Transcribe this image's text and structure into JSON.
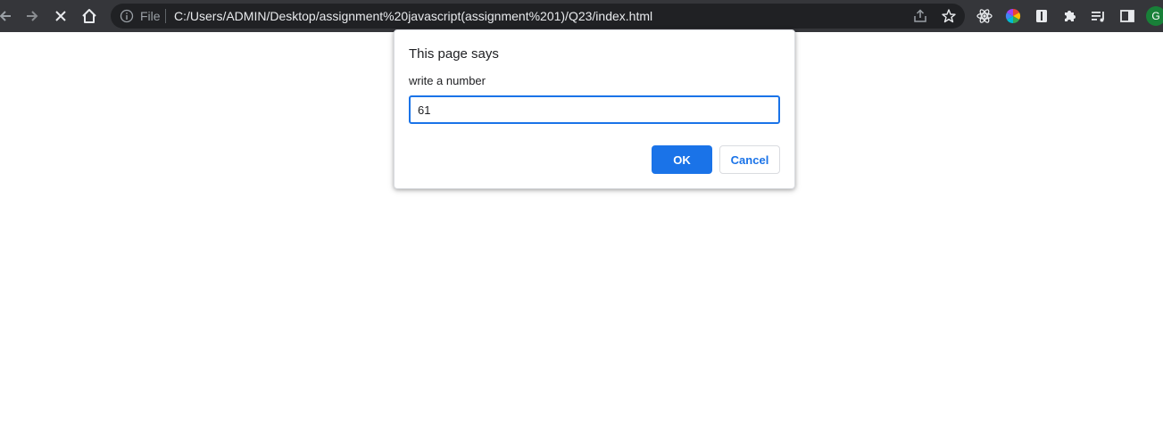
{
  "browser": {
    "scheme_label": "File",
    "url": "C:/Users/ADMIN/Desktop/assignment%20javascript(assignment%201)/Q23/index.html",
    "profile_initial": "G",
    "icons": {
      "back": "arrow-left-icon",
      "forward": "arrow-right-icon",
      "stop": "close-icon",
      "home": "home-icon",
      "info": "info-icon",
      "share": "share-icon",
      "bookmark": "star-icon",
      "extensions": [
        "react-devtools-icon",
        "color-wheel-icon",
        "reader-mode-icon",
        "puzzle-icon",
        "media-queue-icon",
        "side-panel-icon"
      ]
    }
  },
  "dialog": {
    "title": "This page says",
    "message": "write a number",
    "input_value": "61",
    "ok_label": "OK",
    "cancel_label": "Cancel"
  },
  "colors": {
    "toolbar_bg": "#35363a",
    "omnibox_bg": "#202124",
    "accent": "#1a73e8",
    "avatar_bg": "#188038"
  }
}
